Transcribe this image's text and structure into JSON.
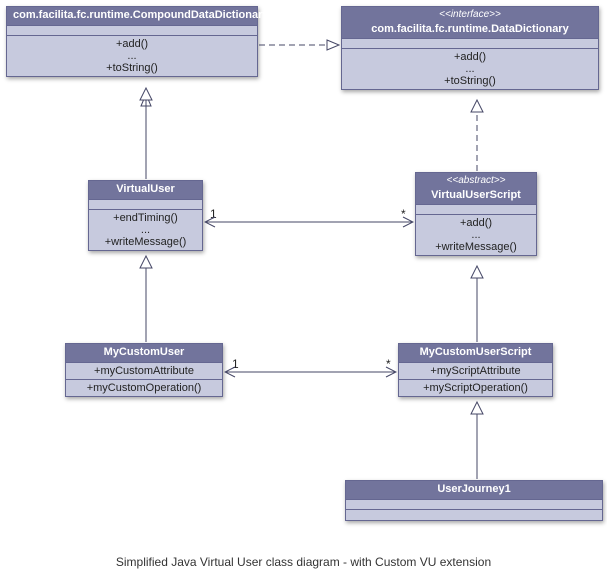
{
  "caption": "Simplified Java Virtual User class diagram - with Custom VU extension",
  "colors": {
    "classFill": "#c7cade",
    "classHeader": "#72749c",
    "border": "#656791"
  },
  "classes": {
    "compound": {
      "name": "com.facilita.fc.runtime.CompoundDataDictionary",
      "ops": [
        "+add()",
        "...",
        "+toString()"
      ]
    },
    "datadict": {
      "stereo": "<<interface>>",
      "name": "com.facilita.fc.runtime.DataDictionary",
      "ops": [
        "+add()",
        "...",
        "+toString()"
      ]
    },
    "virtualuser": {
      "name": "VirtualUser",
      "ops": [
        "+endTiming()",
        "...",
        "+writeMessage()"
      ]
    },
    "vuscript": {
      "stereo": "<<abstract>>",
      "name": "VirtualUserScript",
      "ops": [
        "+add()",
        "...",
        "+writeMessage()"
      ]
    },
    "mycustomuser": {
      "name": "MyCustomUser",
      "attrs": [
        "+myCustomAttribute"
      ],
      "ops": [
        "+myCustomOperation()"
      ]
    },
    "mycustomscript": {
      "name": "MyCustomUserScript",
      "attrs": [
        "+myScriptAttribute"
      ],
      "ops": [
        "+myScriptOperation()"
      ]
    },
    "userjourney": {
      "name": "UserJourney1"
    }
  },
  "assoc1": {
    "leftMult": "1",
    "rightMult": "*"
  },
  "assoc2": {
    "leftMult": "1",
    "rightMult": "*"
  }
}
